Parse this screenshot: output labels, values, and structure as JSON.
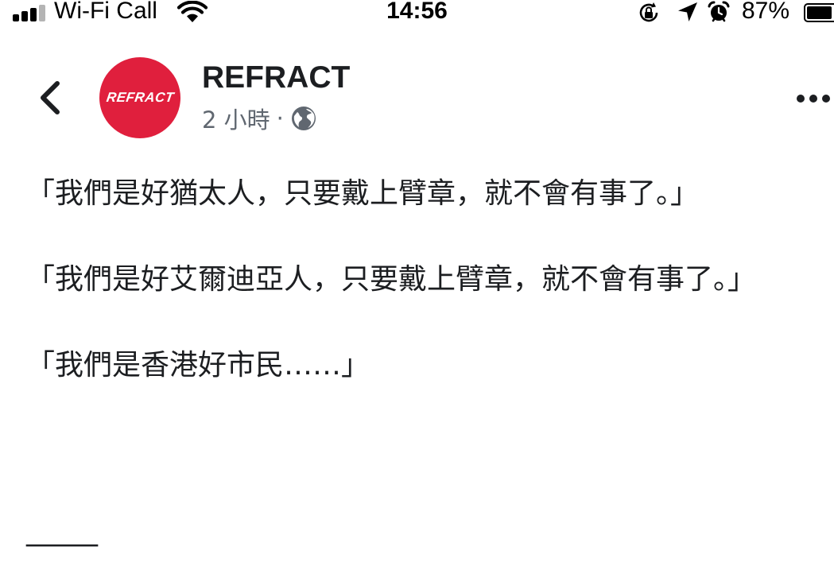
{
  "status_bar": {
    "carrier": "Wi-Fi Call",
    "time": "14:56",
    "battery_percent": "87%",
    "battery_level": 0.87,
    "signal_bars_total": 4,
    "signal_bars_active": 3,
    "icons": [
      "signal-icon",
      "wifi-icon",
      "rotation-lock-icon",
      "location-icon",
      "alarm-icon",
      "battery-icon"
    ]
  },
  "post": {
    "page_name": "REFRACT",
    "avatar_text": "REFRACT",
    "avatar_color": "#e01f3d",
    "timestamp": "2 小時",
    "separator": "·",
    "audience_icon": "globe-icon",
    "paragraphs": [
      "「我們是好猶太人，只要戴上臂章，就不會有事了。」",
      "「我們是好艾爾迪亞人，只要戴上臂章，就不會有事了。」",
      "「我們是香港好市民……」"
    ],
    "divider": "_____"
  },
  "colors": {
    "text": "#1c1e21",
    "meta_text": "#606770",
    "background": "#ffffff"
  }
}
